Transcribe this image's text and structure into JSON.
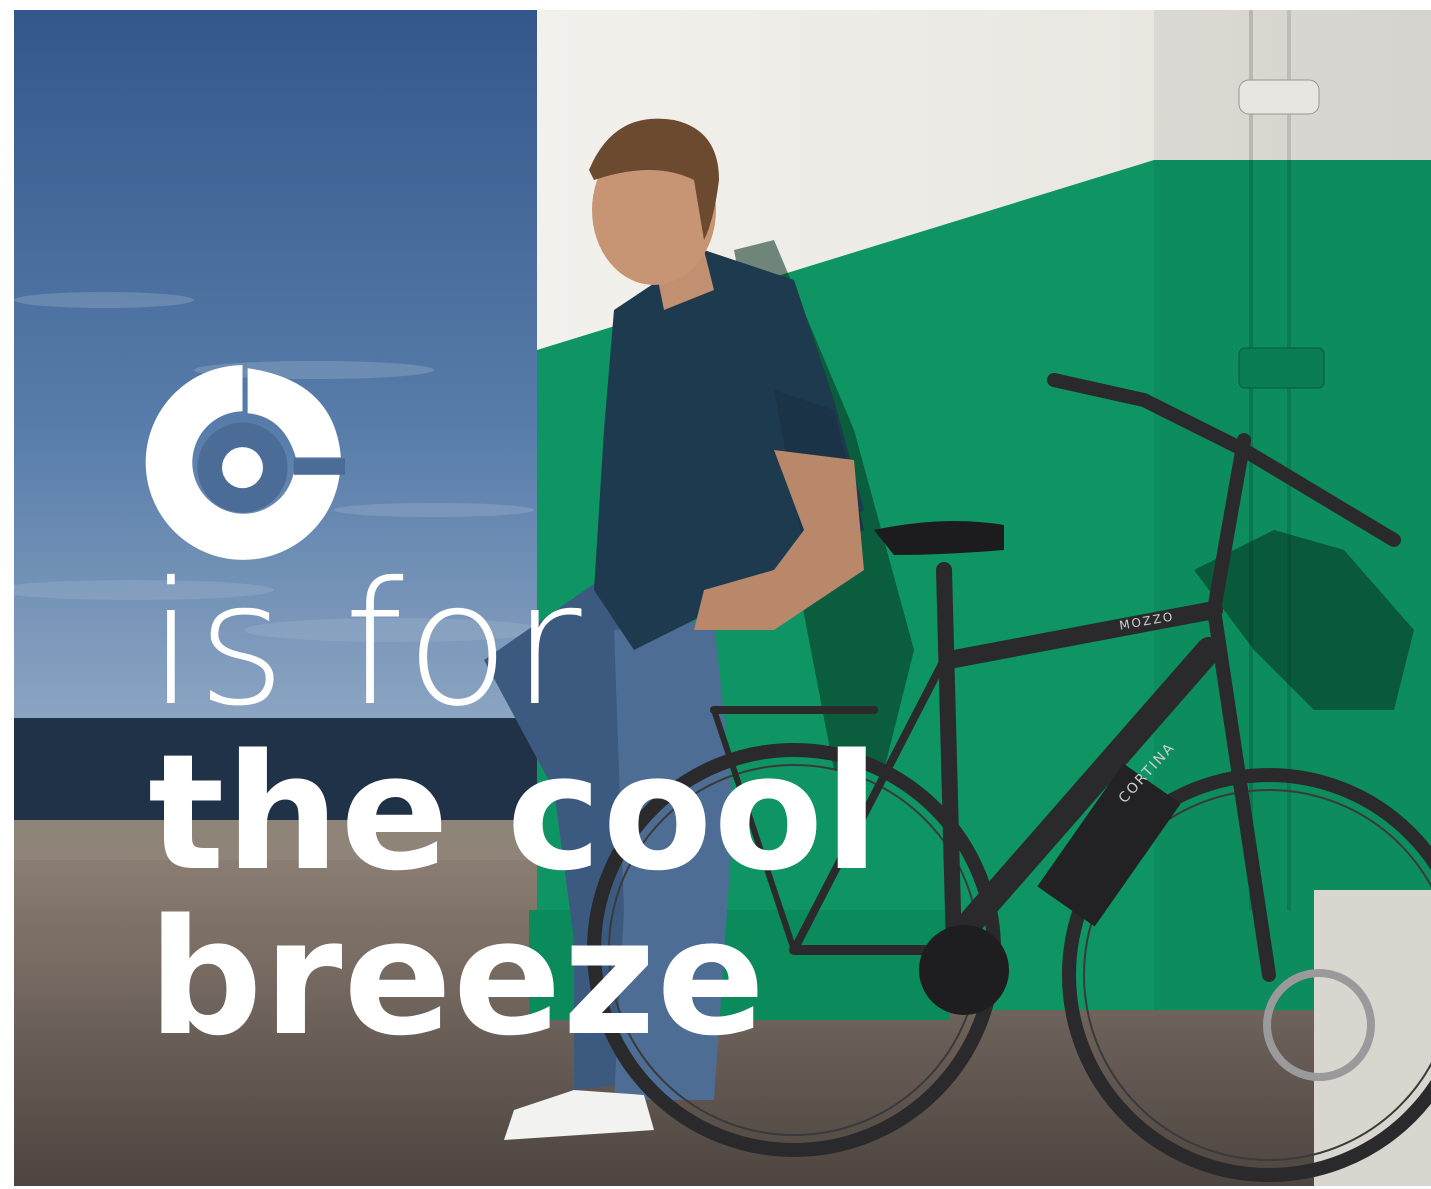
{
  "headline": {
    "line1": "is for",
    "line2": "the cool",
    "line3": "breeze"
  },
  "bike_labels": {
    "frame_top": "MOZZO",
    "down_tube": "CORTINA"
  },
  "logo": {
    "icon": "cortina-logo-icon",
    "color": "#ffffff"
  },
  "colors": {
    "sky": "#3c6496",
    "sea": "#1c2e42",
    "wall_white": "#ecebe6",
    "wall_green": "#0f9563",
    "ground": "#6e6259",
    "text": "#ffffff"
  }
}
